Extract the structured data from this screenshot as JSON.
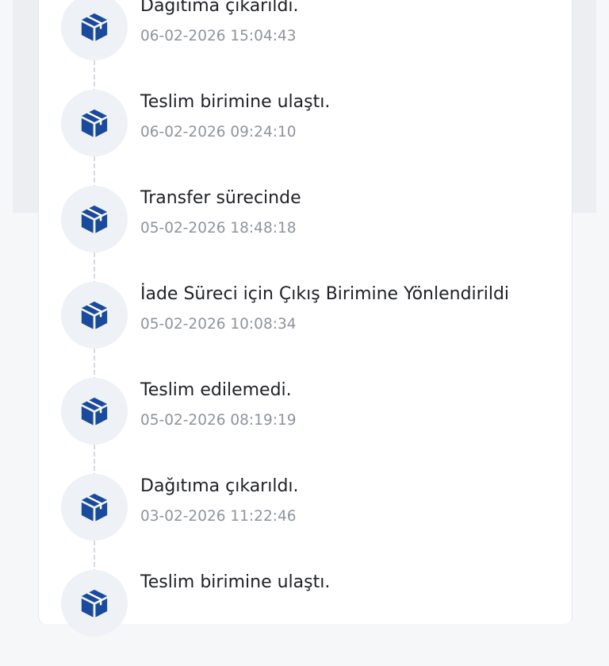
{
  "colors": {
    "icon_blue": "#1a4a9c",
    "icon_circle_bg": "#eef1f6",
    "title_text": "#1f2127",
    "timestamp_text": "#8f949d"
  },
  "tracking": {
    "events": [
      {
        "icon": "package-icon",
        "status": "Dağıtıma çıkarıldı.",
        "timestamp": "06-02-2026 15:04:43"
      },
      {
        "icon": "package-icon",
        "status": "Teslim birimine ulaştı.",
        "timestamp": "06-02-2026 09:24:10"
      },
      {
        "icon": "package-icon",
        "status": "Transfer sürecinde",
        "timestamp": "05-02-2026 18:48:18"
      },
      {
        "icon": "package-icon",
        "status": "İade Süreci için Çıkış Birimine Yönlendirildi",
        "timestamp": "05-02-2026 10:08:34"
      },
      {
        "icon": "package-icon",
        "status": "Teslim edilemedi.",
        "timestamp": "05-02-2026 08:19:19"
      },
      {
        "icon": "package-icon",
        "status": "Dağıtıma çıkarıldı.",
        "timestamp": "03-02-2026 11:22:46"
      },
      {
        "icon": "package-icon",
        "status": "Teslim birimine ulaştı.",
        "timestamp": ""
      }
    ]
  }
}
